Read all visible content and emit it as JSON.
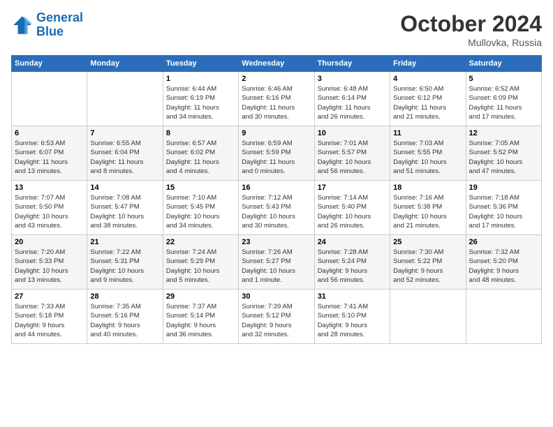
{
  "header": {
    "logo_line1": "General",
    "logo_line2": "Blue",
    "month": "October 2024",
    "location": "Mullovka, Russia"
  },
  "weekdays": [
    "Sunday",
    "Monday",
    "Tuesday",
    "Wednesday",
    "Thursday",
    "Friday",
    "Saturday"
  ],
  "weeks": [
    [
      {
        "day": "",
        "info": ""
      },
      {
        "day": "",
        "info": ""
      },
      {
        "day": "1",
        "info": "Sunrise: 6:44 AM\nSunset: 6:19 PM\nDaylight: 11 hours\nand 34 minutes."
      },
      {
        "day": "2",
        "info": "Sunrise: 6:46 AM\nSunset: 6:16 PM\nDaylight: 11 hours\nand 30 minutes."
      },
      {
        "day": "3",
        "info": "Sunrise: 6:48 AM\nSunset: 6:14 PM\nDaylight: 11 hours\nand 26 minutes."
      },
      {
        "day": "4",
        "info": "Sunrise: 6:50 AM\nSunset: 6:12 PM\nDaylight: 11 hours\nand 21 minutes."
      },
      {
        "day": "5",
        "info": "Sunrise: 6:52 AM\nSunset: 6:09 PM\nDaylight: 11 hours\nand 17 minutes."
      }
    ],
    [
      {
        "day": "6",
        "info": "Sunrise: 6:53 AM\nSunset: 6:07 PM\nDaylight: 11 hours\nand 13 minutes."
      },
      {
        "day": "7",
        "info": "Sunrise: 6:55 AM\nSunset: 6:04 PM\nDaylight: 11 hours\nand 8 minutes."
      },
      {
        "day": "8",
        "info": "Sunrise: 6:57 AM\nSunset: 6:02 PM\nDaylight: 11 hours\nand 4 minutes."
      },
      {
        "day": "9",
        "info": "Sunrise: 6:59 AM\nSunset: 5:59 PM\nDaylight: 11 hours\nand 0 minutes."
      },
      {
        "day": "10",
        "info": "Sunrise: 7:01 AM\nSunset: 5:57 PM\nDaylight: 10 hours\nand 56 minutes."
      },
      {
        "day": "11",
        "info": "Sunrise: 7:03 AM\nSunset: 5:55 PM\nDaylight: 10 hours\nand 51 minutes."
      },
      {
        "day": "12",
        "info": "Sunrise: 7:05 AM\nSunset: 5:52 PM\nDaylight: 10 hours\nand 47 minutes."
      }
    ],
    [
      {
        "day": "13",
        "info": "Sunrise: 7:07 AM\nSunset: 5:50 PM\nDaylight: 10 hours\nand 43 minutes."
      },
      {
        "day": "14",
        "info": "Sunrise: 7:08 AM\nSunset: 5:47 PM\nDaylight: 10 hours\nand 38 minutes."
      },
      {
        "day": "15",
        "info": "Sunrise: 7:10 AM\nSunset: 5:45 PM\nDaylight: 10 hours\nand 34 minutes."
      },
      {
        "day": "16",
        "info": "Sunrise: 7:12 AM\nSunset: 5:43 PM\nDaylight: 10 hours\nand 30 minutes."
      },
      {
        "day": "17",
        "info": "Sunrise: 7:14 AM\nSunset: 5:40 PM\nDaylight: 10 hours\nand 26 minutes."
      },
      {
        "day": "18",
        "info": "Sunrise: 7:16 AM\nSunset: 5:38 PM\nDaylight: 10 hours\nand 21 minutes."
      },
      {
        "day": "19",
        "info": "Sunrise: 7:18 AM\nSunset: 5:36 PM\nDaylight: 10 hours\nand 17 minutes."
      }
    ],
    [
      {
        "day": "20",
        "info": "Sunrise: 7:20 AM\nSunset: 5:33 PM\nDaylight: 10 hours\nand 13 minutes."
      },
      {
        "day": "21",
        "info": "Sunrise: 7:22 AM\nSunset: 5:31 PM\nDaylight: 10 hours\nand 9 minutes."
      },
      {
        "day": "22",
        "info": "Sunrise: 7:24 AM\nSunset: 5:29 PM\nDaylight: 10 hours\nand 5 minutes."
      },
      {
        "day": "23",
        "info": "Sunrise: 7:26 AM\nSunset: 5:27 PM\nDaylight: 10 hours\nand 1 minute."
      },
      {
        "day": "24",
        "info": "Sunrise: 7:28 AM\nSunset: 5:24 PM\nDaylight: 9 hours\nand 56 minutes."
      },
      {
        "day": "25",
        "info": "Sunrise: 7:30 AM\nSunset: 5:22 PM\nDaylight: 9 hours\nand 52 minutes."
      },
      {
        "day": "26",
        "info": "Sunrise: 7:32 AM\nSunset: 5:20 PM\nDaylight: 9 hours\nand 48 minutes."
      }
    ],
    [
      {
        "day": "27",
        "info": "Sunrise: 7:33 AM\nSunset: 5:18 PM\nDaylight: 9 hours\nand 44 minutes."
      },
      {
        "day": "28",
        "info": "Sunrise: 7:35 AM\nSunset: 5:16 PM\nDaylight: 9 hours\nand 40 minutes."
      },
      {
        "day": "29",
        "info": "Sunrise: 7:37 AM\nSunset: 5:14 PM\nDaylight: 9 hours\nand 36 minutes."
      },
      {
        "day": "30",
        "info": "Sunrise: 7:39 AM\nSunset: 5:12 PM\nDaylight: 9 hours\nand 32 minutes."
      },
      {
        "day": "31",
        "info": "Sunrise: 7:41 AM\nSunset: 5:10 PM\nDaylight: 9 hours\nand 28 minutes."
      },
      {
        "day": "",
        "info": ""
      },
      {
        "day": "",
        "info": ""
      }
    ]
  ]
}
